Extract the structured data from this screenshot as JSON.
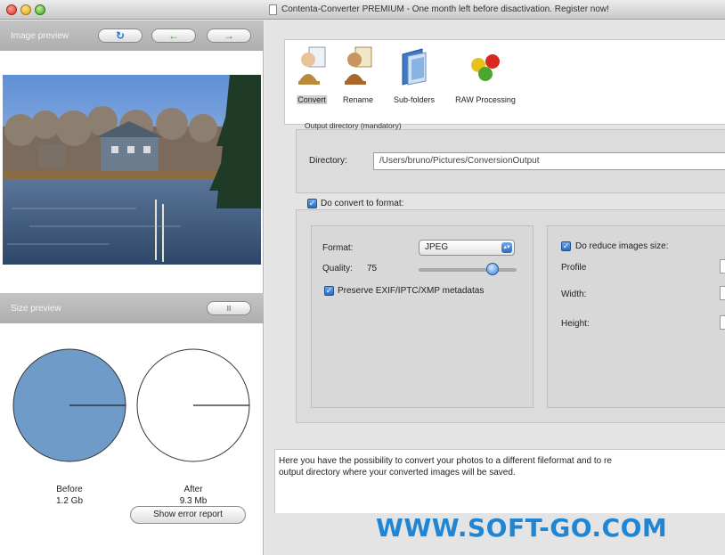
{
  "window": {
    "title": "Contenta-Converter PREMIUM - One month left before disactivation. Register now!"
  },
  "image_preview": {
    "label": "Image preview",
    "rotate_icon": "rotate-icon",
    "prev_icon": "arrow-left-icon",
    "next_icon": "arrow-right-icon"
  },
  "size_preview": {
    "label": "Size preview",
    "toggle_label": "II",
    "before_label": "Before",
    "before_value": "1.2 Gb",
    "after_label": "After",
    "after_value": "9.3 Mb",
    "pie_color": "#6f9bc8"
  },
  "error_button": {
    "label": "Show error report"
  },
  "toolbar": {
    "items": [
      {
        "label": "Convert",
        "icon": "person-picture-icon",
        "selected": true
      },
      {
        "label": "Rename",
        "icon": "person-rename-icon",
        "selected": false
      },
      {
        "label": "Sub-folders",
        "icon": "folder-icon",
        "selected": false
      },
      {
        "label": "RAW Processing",
        "icon": "color-balls-icon",
        "selected": false
      }
    ]
  },
  "output": {
    "section_title": "Output directory (mandatory)",
    "directory_label": "Directory:",
    "directory_value": "/Users/bruno/Pictures/ConversionOutput"
  },
  "convert": {
    "checkbox_label": "Do convert to format:",
    "checked": true,
    "format_label": "Format:",
    "format_value": "JPEG",
    "quality_label": "Quality:",
    "quality_value": "75",
    "preserve_label": "Preserve EXIF/IPTC/XMP metadatas",
    "preserve_checked": true
  },
  "reduce": {
    "checkbox_label": "Do reduce images size:",
    "checked": true,
    "profile_label": "Profile",
    "width_label": "Width:",
    "height_label": "Height:"
  },
  "description": {
    "line1": "Here you have the possibility to convert your photos to a different fileformat and to re",
    "line2": "output directory where your converted images will be saved."
  },
  "watermark": {
    "text": "WWW.SOFT-GO.COM"
  },
  "colors": {
    "accent": "#2b6cc4",
    "watermark": "#1f86d6"
  }
}
